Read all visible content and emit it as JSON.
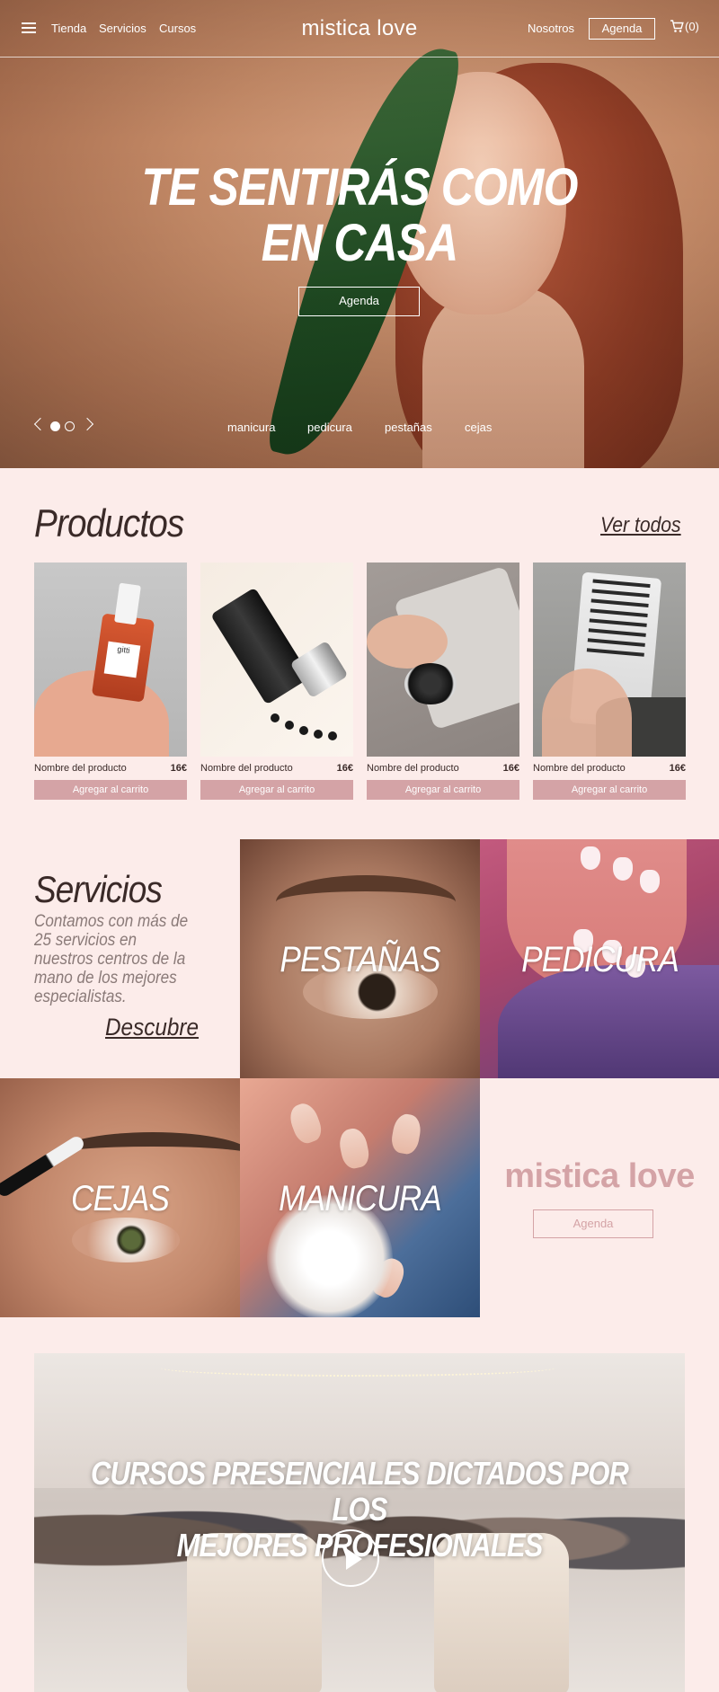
{
  "nav": {
    "links": [
      "Tienda",
      "Servicios",
      "Cursos"
    ],
    "brand": "mistica love",
    "about": "Nosotros",
    "agenda": "Agenda",
    "cart": "(0)"
  },
  "hero": {
    "title_line1": "TE SENTIRÁS COMO",
    "title_line2": "EN CASA",
    "button": "Agenda",
    "categories": [
      "manicura",
      "pedicura",
      "pestañas",
      "cejas"
    ],
    "slides_total": 2,
    "slide_active": 1
  },
  "products": {
    "title": "Productos",
    "see_all": "Ver todos",
    "items": [
      {
        "name": "Nombre del producto",
        "price": "16€",
        "button": "Agregar al carrito",
        "brand_label": "gitti"
      },
      {
        "name": "Nombre del producto",
        "price": "16€",
        "button": "Agregar al carrito"
      },
      {
        "name": "Nombre del producto",
        "price": "16€",
        "button": "Agregar al carrito"
      },
      {
        "name": "Nombre del producto",
        "price": "16€",
        "button": "Agregar al carrito"
      }
    ]
  },
  "services": {
    "title": "Servicios",
    "description": "Contamos con más de 25 servicios en nuestros centros de la mano de los mejores especialistas.",
    "cta": "Descubre",
    "tiles": [
      "PESTAÑAS",
      "PEDICURA",
      "CEJAS",
      "MANICURA"
    ],
    "brand": "mistica love",
    "brand_button": "Agenda"
  },
  "courses": {
    "title_line1": "CURSOS PRESENCIALES DICTADOS POR LOS",
    "title_line2": "MEJORES PROFESIONALES"
  },
  "colors": {
    "background": "#fcecea",
    "accent": "#d4a3a6",
    "text": "#3a2a28"
  }
}
